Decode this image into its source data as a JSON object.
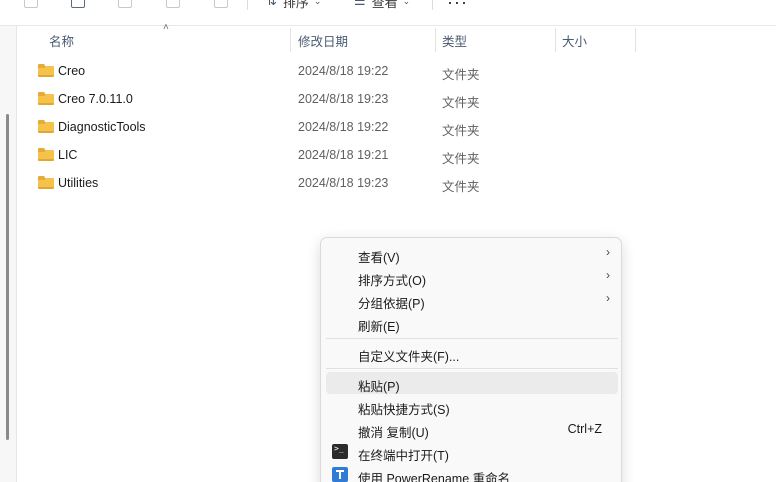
{
  "toolbar": {
    "sort_label": "排序",
    "view_label": "查看",
    "more_label": "···"
  },
  "columns": {
    "name": "名称",
    "modified": "修改日期",
    "type": "类型",
    "size": "大小"
  },
  "files": [
    {
      "name": "Creo",
      "modified": "2024/8/18 19:22",
      "type": "文件夹"
    },
    {
      "name": "Creo 7.0.11.0",
      "modified": "2024/8/18 19:23",
      "type": "文件夹"
    },
    {
      "name": "DiagnosticTools",
      "modified": "2024/8/18 19:22",
      "type": "文件夹"
    },
    {
      "name": "LIC",
      "modified": "2024/8/18 19:21",
      "type": "文件夹"
    },
    {
      "name": "Utilities",
      "modified": "2024/8/18 19:23",
      "type": "文件夹"
    }
  ],
  "context_menu": {
    "view": "查看(V)",
    "sort_by": "排序方式(O)",
    "group_by": "分组依据(P)",
    "refresh": "刷新(E)",
    "customize": "自定义文件夹(F)...",
    "paste": "粘贴(P)",
    "paste_shortcut": "粘贴快捷方式(S)",
    "undo_copy": "撤消 复制(U)",
    "undo_shortcut": "Ctrl+Z",
    "open_terminal": "在终端中打开(T)",
    "powerrename": "使用 PowerRename 重命名",
    "submenu_arrow": "›"
  }
}
